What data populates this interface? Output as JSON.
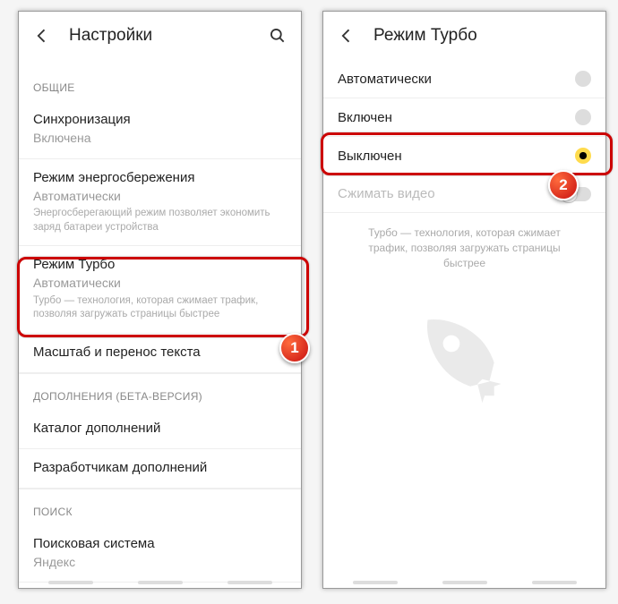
{
  "left": {
    "title": "Настройки",
    "sections": {
      "general": {
        "header": "ОБЩИЕ",
        "sync": {
          "title": "Синхронизация",
          "value": "Включена"
        },
        "power": {
          "title": "Режим энергосбережения",
          "value": "Автоматически",
          "desc": "Энергосберегающий режим позволяет экономить заряд батареи устройства"
        },
        "turbo": {
          "title": "Режим Турбо",
          "value": "Автоматически",
          "desc": "Турбо — технология, которая сжимает трафик, позволяя загружать страницы быстрее"
        },
        "scale": {
          "title": "Масштаб и перенос текста"
        }
      },
      "addons": {
        "header": "ДОПОЛНЕНИЯ (БЕТА-ВЕРСИЯ)",
        "catalog": {
          "title": "Каталог дополнений"
        },
        "dev": {
          "title": "Разработчикам дополнений"
        }
      },
      "search": {
        "header": "ПОИСК",
        "engine": {
          "title": "Поисковая система",
          "value": "Яндекс"
        }
      }
    }
  },
  "right": {
    "title": "Режим Турбо",
    "options": {
      "auto": "Автоматически",
      "on": "Включен",
      "off": "Выключен",
      "compress": "Сжимать видео"
    },
    "hint": "Турбо — технология, которая сжимает трафик, позволяя загружать страницы быстрее"
  },
  "badges": {
    "one": "1",
    "two": "2"
  }
}
